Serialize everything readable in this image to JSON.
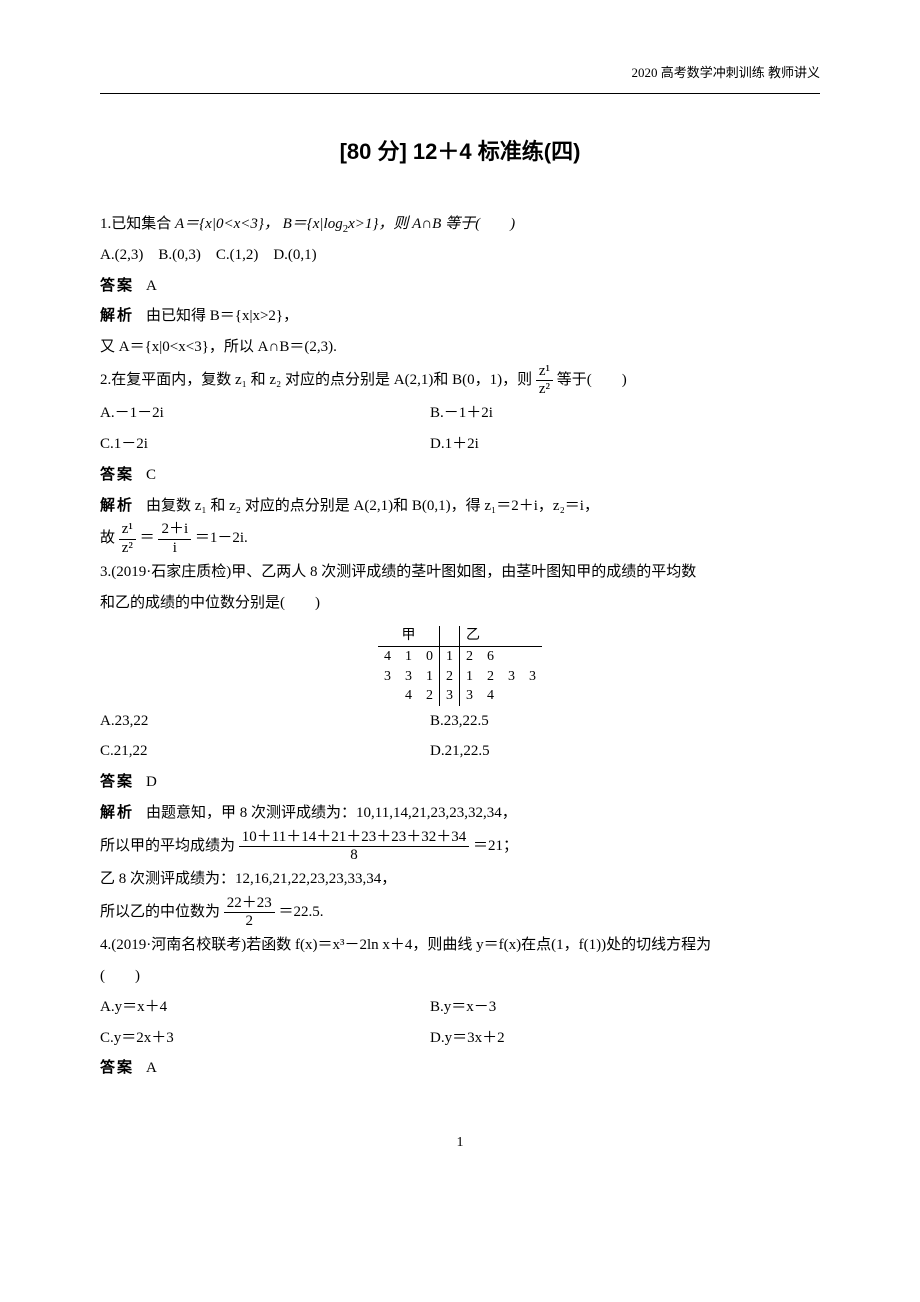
{
  "header": "2020 高考数学冲刺训练 教师讲义",
  "title": "[80 分] 12＋4 标准练(四)",
  "q1": {
    "text_front": "1.已知集合 ",
    "A_def": "A＝{x|0<x<3}，",
    "B_def": "B＝{x|log",
    "B_def_sub": "2",
    "B_def_tail": "x>1}，则 A∩B 等于(  )",
    "options": "A.(2,3) B.(0,3) C.(1,2) D.(0,1)",
    "ans_label": "答案",
    "ans": "A",
    "exp_label": "解析",
    "exp1_a": "由已知得 B＝{x|x>2}，",
    "exp2": "又 A＝{x|0<x<3}，所以 A∩B＝(2,3)."
  },
  "q2": {
    "text": "2.在复平面内，复数 z₁ 和 z₂ 对应的点分别是 A(2,1)和 B(0，1)，则",
    "frac_num": "z¹",
    "frac_den": "z²",
    "tail": "等于(  )",
    "optA": "A.－1－2i",
    "optB": "B.－1＋2i",
    "optC": "C.1－2i",
    "optD": "D.1＋2i",
    "ans_label": "答案",
    "ans": "C",
    "exp_label": "解析",
    "exp1": "由复数 z₁ 和 z₂ 对应的点分别是 A(2,1)和 B(0,1)，得 z₁＝2＋i，z₂＝i，",
    "exp2_pre": "故",
    "exp2_n1": "z¹",
    "exp2_d1": "z²",
    "exp2_eq": "＝",
    "exp2_n2": "2＋i",
    "exp2_d2": "i",
    "exp2_tail": "＝1－2i."
  },
  "q3": {
    "text1": "3.(2019·石家庄质检)甲、乙两人 8 次测评成绩的茎叶图如图，由茎叶图知甲的成绩的平均数",
    "text2": "和乙的成绩的中位数分别是(  )",
    "hdr_l": "甲",
    "hdr_r": "乙",
    "row1_l": "4 1 0",
    "row1_s": "1",
    "row1_r": "2 6",
    "row2_l": "3 3 1",
    "row2_s": "2",
    "row2_r": "1 2 3 3",
    "row3_l": "4 2",
    "row3_s": "3",
    "row3_r": "3 4",
    "optA": "A.23,22",
    "optB": "B.23,22.5",
    "optC": "C.21,22",
    "optD": "D.21,22.5",
    "ans_label": "答案",
    "ans": "D",
    "exp_label": "解析",
    "exp1": "由题意知，甲 8 次测评成绩为：10,11,14,21,23,23,32,34，",
    "exp2_pre": "所以甲的平均成绩为",
    "exp2_num": "10＋11＋14＋21＋23＋23＋32＋34",
    "exp2_den": "8",
    "exp2_tail": "＝21；",
    "exp3": "乙 8 次测评成绩为：12,16,21,22,23,23,33,34，",
    "exp4_pre": "所以乙的中位数为",
    "exp4_num": "22＋23",
    "exp4_den": "2",
    "exp4_tail": "＝22.5."
  },
  "q4": {
    "text": "4.(2019·河南名校联考)若函数 f(x)＝x³－2ln x＋4，则曲线 y＝f(x)在点(1，f(1))处的切线方程为",
    "paren": "(  )",
    "optA": "A.y＝x＋4",
    "optB": "B.y＝x－3",
    "optC": "C.y＝2x＋3",
    "optD": "D.y＝3x＋2",
    "ans_label": "答案",
    "ans": "A"
  },
  "page_number": "1"
}
